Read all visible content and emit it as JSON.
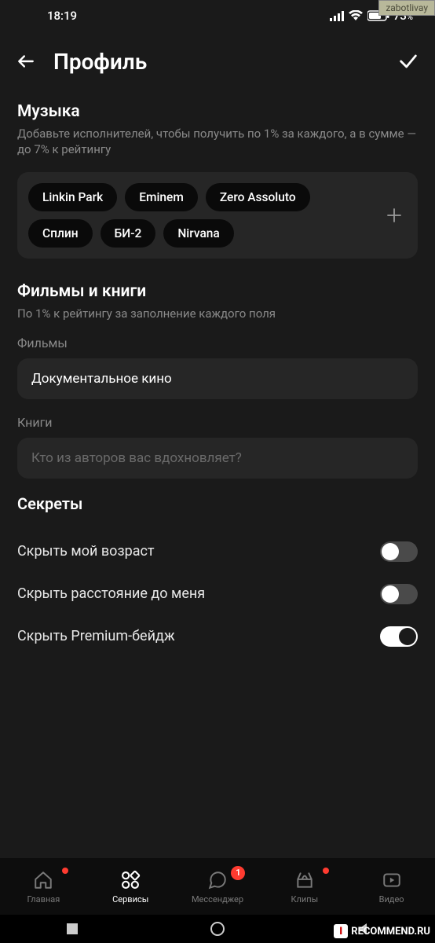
{
  "status": {
    "time": "18:19",
    "battery": "73",
    "battery_suffix": "%"
  },
  "header": {
    "title": "Профиль"
  },
  "music": {
    "title": "Музыка",
    "subtitle": "Добавьте исполнителей, чтобы получить по 1% за каждого, а в сумме — до 7% к рейтингу",
    "chips": [
      "Linkin Park",
      "Eminem",
      "Zero Assoluto",
      "Сплин",
      "БИ-2",
      "Nirvana"
    ]
  },
  "films_books": {
    "title": "Фильмы и книги",
    "subtitle": "По 1% к рейтингу за заполнение каждого поля",
    "films_label": "Фильмы",
    "films_value": "Документальное кино",
    "books_label": "Книги",
    "books_placeholder": "Кто из авторов вас вдохновляет?"
  },
  "secrets": {
    "title": "Секреты",
    "items": [
      {
        "label": "Скрыть мой возраст",
        "on": false
      },
      {
        "label": "Скрыть расстояние до меня",
        "on": false
      },
      {
        "label": "Скрыть Premium-бейдж",
        "on": true
      }
    ]
  },
  "nav": {
    "items": [
      {
        "label": "Главная",
        "dot": true,
        "badge": null,
        "active": false
      },
      {
        "label": "Сервисы",
        "dot": false,
        "badge": null,
        "active": true
      },
      {
        "label": "Мессенджер",
        "dot": false,
        "badge": "1",
        "active": false
      },
      {
        "label": "Клипы",
        "dot": true,
        "badge": null,
        "active": false
      },
      {
        "label": "Видео",
        "dot": false,
        "badge": null,
        "active": false
      }
    ]
  },
  "watermark": {
    "top": "zabotlivay",
    "bottom": "RECOMMEND.RU"
  }
}
